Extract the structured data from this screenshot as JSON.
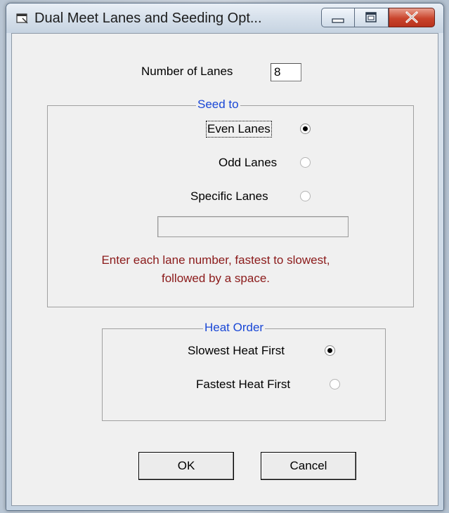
{
  "window": {
    "title": "Dual Meet Lanes and Seeding Opt..."
  },
  "lanes": {
    "label": "Number of Lanes",
    "value": "8"
  },
  "seed_to": {
    "legend": "Seed to",
    "options": [
      {
        "label": "Even Lanes",
        "checked": true
      },
      {
        "label": "Odd Lanes",
        "checked": false
      },
      {
        "label": "Specific Lanes",
        "checked": false
      }
    ],
    "specific_lanes_value": "",
    "hint_line1": "Enter each lane number, fastest to slowest,",
    "hint_line2": "followed by a space."
  },
  "heat_order": {
    "legend": "Heat Order",
    "options": [
      {
        "label": "Slowest Heat First",
        "checked": true
      },
      {
        "label": "Fastest Heat First",
        "checked": false
      }
    ]
  },
  "buttons": {
    "ok": "OK",
    "cancel": "Cancel"
  },
  "icons": {
    "app": "dialog-icon",
    "minimize": "minimize-icon",
    "maximize": "maximize-icon",
    "close": "close-icon"
  },
  "colors": {
    "legend_text": "#1947d6",
    "hint_text": "#8b1a1a",
    "close_button": "#c9442c"
  }
}
